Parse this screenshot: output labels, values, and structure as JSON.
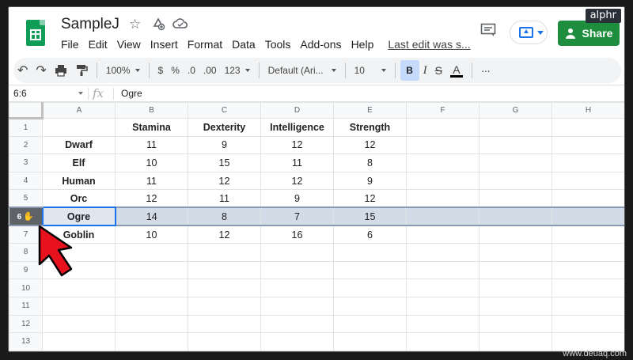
{
  "watermark": {
    "top": "alphr",
    "bottom": "www.deuaq.com"
  },
  "header": {
    "title": "SampleJ",
    "icons": [
      "star-icon",
      "move-to-drive-icon",
      "cloud-status-icon"
    ],
    "menu": [
      "File",
      "Edit",
      "View",
      "Insert",
      "Format",
      "Data",
      "Tools",
      "Add-ons",
      "Help"
    ],
    "last_edit": "Last edit was s...",
    "share_label": "Share",
    "accent": "#1e8e3e"
  },
  "toolbar": {
    "zoom": "100%",
    "currency": "$",
    "percent": "%",
    "decrease_decimal": ".0",
    "increase_decimal": ".00",
    "more_formats": "123",
    "font": "Default (Ari...",
    "font_size": "10",
    "bold": "B",
    "italic": "I",
    "strike": "S",
    "text_color": "A",
    "more": "···"
  },
  "formula_bar": {
    "name_box": "6:6",
    "fx": "fx",
    "value": "Ogre"
  },
  "grid": {
    "columns": [
      "A",
      "B",
      "C",
      "D",
      "E",
      "F",
      "G",
      "H"
    ],
    "row_numbers": [
      "1",
      "2",
      "3",
      "4",
      "5",
      "6",
      "7",
      "8",
      "9",
      "10",
      "11",
      "12",
      "13"
    ],
    "header_row": [
      "",
      "Stamina",
      "Dexterity",
      "Intelligence",
      "Strength"
    ],
    "rows": [
      [
        "Dwarf",
        "11",
        "9",
        "12",
        "12"
      ],
      [
        "Elf",
        "10",
        "15",
        "11",
        "8"
      ],
      [
        "Human",
        "11",
        "12",
        "12",
        "9"
      ],
      [
        "Orc",
        "12",
        "11",
        "9",
        "12"
      ],
      [
        "Ogre",
        "14",
        "8",
        "7",
        "15"
      ],
      [
        "Goblin",
        "10",
        "12",
        "16",
        "6"
      ]
    ],
    "selected_row": "6",
    "selection_color": "#d3dbe6"
  }
}
